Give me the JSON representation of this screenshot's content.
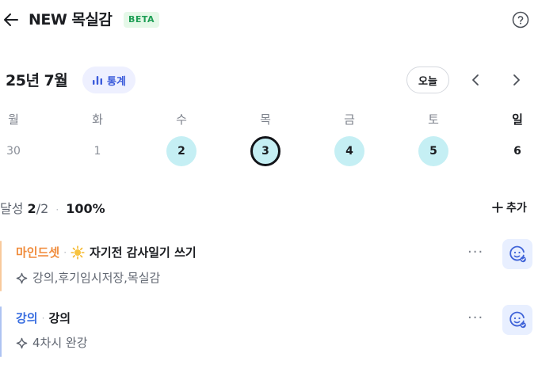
{
  "header": {
    "title": "NEW 목실감",
    "badge": "BETA",
    "back_icon": "arrow-left-icon",
    "help_icon": "question-circle-icon"
  },
  "calendar": {
    "month_label": "25년 7월",
    "stats_label": "통계",
    "today_label": "오늘",
    "weekdays": [
      "월",
      "화",
      "수",
      "목",
      "금",
      "토",
      "일"
    ],
    "dates": [
      "30",
      "1",
      "2",
      "3",
      "4",
      "5",
      "6"
    ],
    "completed_dates": [
      "2",
      "3",
      "4",
      "5"
    ],
    "selected_date": "3"
  },
  "summary": {
    "label": "달성",
    "done": "2",
    "total": "/2",
    "separator": "·",
    "percent": "100%",
    "add_label": "추가"
  },
  "tasks": [
    {
      "category": "마인드셋",
      "separator": "·",
      "emoji": "🌞",
      "title": "자기전 감사일기 쓰기",
      "tags": "강의,후기임시저장,목실감",
      "category_color": "#f08c3c",
      "bar_color": "#f8c99c",
      "more": "···"
    },
    {
      "category": "강의",
      "separator": "·",
      "title": "강의",
      "tags": "4차시 완강",
      "category_color": "#3b6fe0",
      "bar_color": "#aec3f2",
      "more": "···"
    }
  ],
  "colors": {
    "accent": "#3b5bdb",
    "completed_fill": "#c5eff4",
    "beta_bg": "#e5f8e8",
    "beta_text": "#1e9e55"
  }
}
